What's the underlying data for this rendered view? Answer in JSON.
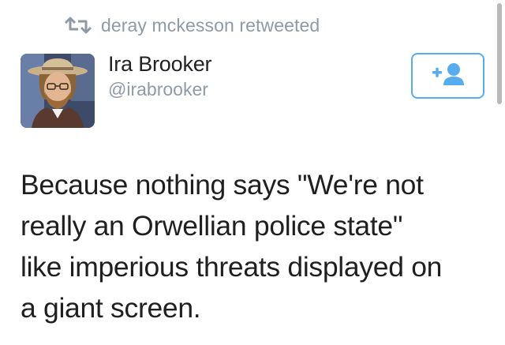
{
  "retweet": {
    "icon": "retweet-icon",
    "text": "deray mckesson retweeted"
  },
  "author": {
    "avatar": "avatar",
    "name": "Ira Brooker",
    "handle": "@irabrooker"
  },
  "follow_button": {
    "icon": "add-user-icon"
  },
  "tweet": {
    "lines": [
      "Because nothing says \"We're not",
      "really an Orwellian police state\"",
      "like imperious threats displayed on",
      "a giant screen."
    ]
  },
  "colors": {
    "accent": "#55acee",
    "muted": "#8e9aa6",
    "text": "#1f1f1f"
  }
}
